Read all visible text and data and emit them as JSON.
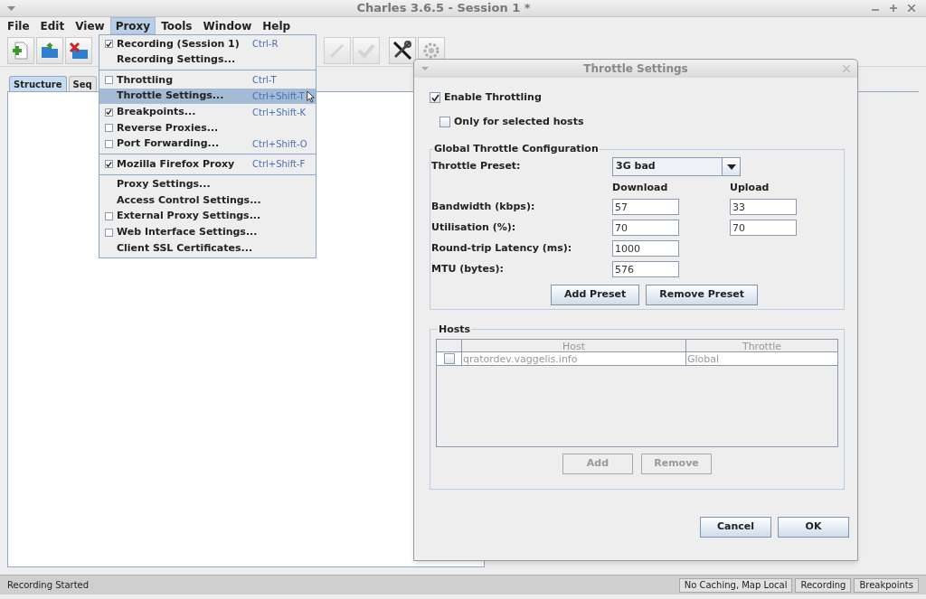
{
  "window": {
    "title": "Charles 3.6.5 - Session 1 *"
  },
  "menubar": [
    {
      "label": "File",
      "selected": false
    },
    {
      "label": "Edit",
      "selected": false
    },
    {
      "label": "View",
      "selected": false
    },
    {
      "label": "Proxy",
      "selected": true
    },
    {
      "label": "Tools",
      "selected": false
    },
    {
      "label": "Window",
      "selected": false
    },
    {
      "label": "Help",
      "selected": false
    }
  ],
  "proxy_menu": {
    "groups": [
      [
        {
          "kind": "check",
          "label": "Recording (Session 1)",
          "checked": true,
          "shortcut": "Ctrl-R",
          "selected": false
        },
        {
          "kind": "plain",
          "label": "Recording Settings...",
          "selected": false
        }
      ],
      [
        {
          "kind": "check",
          "label": "Throttling",
          "checked": false,
          "shortcut": "Ctrl-T",
          "selected": false
        },
        {
          "kind": "plain",
          "label": "Throttle Settings...",
          "shortcut": "Ctrl+Shift-T",
          "selected": true
        },
        {
          "kind": "check",
          "label": "Breakpoints...",
          "checked": true,
          "shortcut": "Ctrl+Shift-K",
          "selected": false
        },
        {
          "kind": "check",
          "label": "Reverse Proxies...",
          "checked": false,
          "selected": false
        },
        {
          "kind": "check",
          "label": "Port Forwarding...",
          "checked": false,
          "shortcut": "Ctrl+Shift-O",
          "selected": false
        }
      ],
      [
        {
          "kind": "check",
          "label": "Mozilla Firefox Proxy",
          "checked": true,
          "shortcut": "Ctrl+Shift-F",
          "selected": false
        }
      ],
      [
        {
          "kind": "plain",
          "label": "Proxy Settings...",
          "selected": false
        },
        {
          "kind": "plain",
          "label": "Access Control Settings...",
          "selected": false
        },
        {
          "kind": "check",
          "label": "External Proxy Settings...",
          "checked": false,
          "selected": false
        },
        {
          "kind": "check",
          "label": "Web Interface Settings...",
          "checked": false,
          "selected": false
        },
        {
          "kind": "plain",
          "label": "Client SSL Certificates...",
          "selected": false
        }
      ]
    ]
  },
  "tabs": [
    {
      "label": "Structure",
      "selected": true
    },
    {
      "label": "Seq",
      "selected": false
    }
  ],
  "dialog": {
    "title": "Throttle Settings",
    "enable_throttling": {
      "label": "Enable Throttling",
      "checked": true
    },
    "only_selected_hosts": {
      "label": "Only for selected hosts",
      "checked": false
    },
    "global": {
      "title": "Global Throttle Configuration",
      "preset_label": "Throttle Preset:",
      "preset_value": "3G bad",
      "columns": [
        "Download",
        "Upload"
      ],
      "rows": [
        {
          "label": "Bandwidth (kbps):",
          "download": "57",
          "upload": "33"
        },
        {
          "label": "Utilisation (%):",
          "download": "70",
          "upload": "70"
        },
        {
          "label": "Round-trip Latency (ms):",
          "download": "1000"
        },
        {
          "label": "MTU (bytes):",
          "download": "576"
        }
      ],
      "buttons": [
        "Add Preset",
        "Remove Preset"
      ]
    },
    "hosts": {
      "title": "Hosts",
      "columns": [
        "Host",
        "Throttle"
      ],
      "rows": [
        {
          "checked": false,
          "host": "qratordev.vaggelis.info",
          "throttle": "Global"
        }
      ],
      "buttons": [
        {
          "label": "Add",
          "disabled": true
        },
        {
          "label": "Remove",
          "disabled": true
        }
      ]
    },
    "buttons": [
      "Cancel",
      "OK"
    ]
  },
  "status_bar": {
    "message": "Recording Started",
    "indicators": [
      "No Caching, Map Local",
      "Recording",
      "Breakpoints"
    ]
  }
}
